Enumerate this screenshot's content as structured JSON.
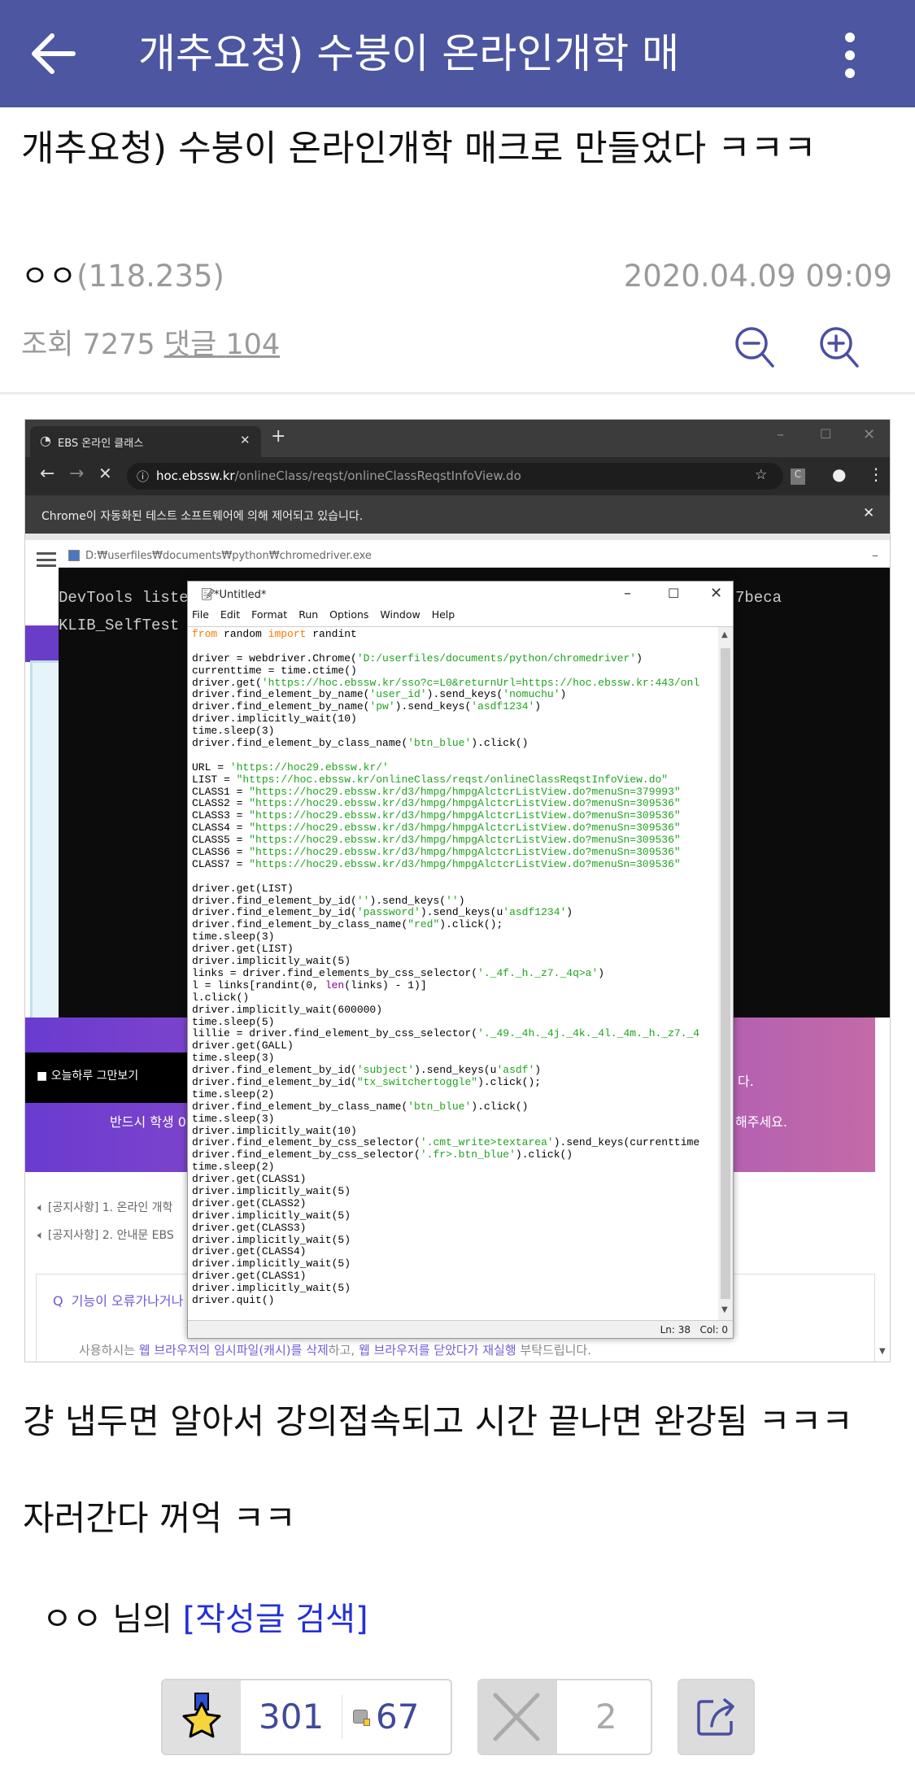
{
  "appbar": {
    "title": "개추요청) 수붕이 온라인개학 매"
  },
  "post": {
    "title": "개추요청) 수붕이 온라인개학 매크로 만들었다 ㅋㅋㅋ",
    "author": "ㅇㅇ",
    "ip": "(118.235)",
    "date": "2020.04.09 09:09",
    "views_label": "조회",
    "views": "7275",
    "comments_label": "댓글",
    "comments": "104",
    "body": [
      "걍 냅두면 알아서 강의접속되고 시간 끝나면 완강됨 ㅋㅋㅋ",
      "자러간다 꺼억 ㅋㅋ"
    ],
    "byline_author": "ㅇㅇ",
    "byline_suffix": "님의",
    "byline_link": "[작성글 검색]"
  },
  "actions": {
    "recommend": "301",
    "fixed_recommend": "67",
    "dislike": "2"
  },
  "colors": {
    "appbar": "#4d56a0",
    "accent": "#4a4fa0",
    "link": "#2430d8"
  },
  "screenshot": {
    "chrome": {
      "tab_title": "EBS 온라인 클래스",
      "url_host": "hoc.ebssw.kr",
      "url_path": "/onlineClass/reqst/onlineClassReqstInfoView.do",
      "infobar": "Chrome이 자동화된 테스트 소프트웨어에 의해 제어되고 있습니다.",
      "profile_badge": "C"
    },
    "console": {
      "title": "D:₩userfiles₩documents₩python₩chromedriver.exe",
      "line1": "DevTools listenin",
      "line2": "KLIB_SelfTest ret",
      "line1_tail": "7beca"
    },
    "page": {
      "dismiss": "오늘하루 그만보기",
      "banner_left": "반드시 학생 0",
      "banner_right1": "다.",
      "banner_right2": "해주세요.",
      "notice1": "[공지사항] 1. 온라인 개학",
      "notice2": "[공지사항] 2. 안내문 EBS",
      "faq_q": "Q",
      "faq_title": "기능이 오류가나거나",
      "faq_text_a": "사용하시는 ",
      "faq_text_b": "웹 브라우저의 임시파일(캐시)를 삭제",
      "faq_text_c": "하고, ",
      "faq_text_d": "웹 브라우저를 닫았다가 재실행",
      "faq_text_e": " 부탁드립니다."
    },
    "idle": {
      "title": "*Untitled*",
      "menu": [
        "File",
        "Edit",
        "Format",
        "Run",
        "Options",
        "Window",
        "Help"
      ],
      "status": "Ln: 38   Col: 0",
      "code": [
        [
          [
            "from",
            "k"
          ],
          [
            " random ",
            ""
          ],
          [
            "import",
            "k"
          ],
          [
            " randint",
            ""
          ]
        ],
        [],
        [
          [
            "driver = webdriver.Chrome(",
            ""
          ],
          [
            "'D:/userfiles/documents/python/chromedriver'",
            "s"
          ],
          [
            ")",
            ""
          ]
        ],
        [
          [
            "currenttime = time.ctime()",
            ""
          ]
        ],
        [
          [
            "driver.get(",
            ""
          ],
          [
            "'https://hoc.ebssw.kr/sso?c=L0&returnUrl=https://hoc.ebssw.kr:443/onl",
            "s"
          ]
        ],
        [
          [
            "driver.find_element_by_name(",
            ""
          ],
          [
            "'user_id'",
            "s"
          ],
          [
            ").send_keys(",
            ""
          ],
          [
            "'nomuchu'",
            "s"
          ],
          [
            ")",
            ""
          ]
        ],
        [
          [
            "driver.find_element_by_name(",
            ""
          ],
          [
            "'pw'",
            "s"
          ],
          [
            ").send_keys(",
            ""
          ],
          [
            "'asdf1234'",
            "s"
          ],
          [
            ")",
            ""
          ]
        ],
        [
          [
            "driver.implicitly_wait(10)",
            ""
          ]
        ],
        [
          [
            "time.sleep(3)",
            ""
          ]
        ],
        [
          [
            "driver.find_element_by_class_name(",
            ""
          ],
          [
            "'btn_blue'",
            "s"
          ],
          [
            ").click()",
            ""
          ]
        ],
        [],
        [
          [
            "URL = ",
            ""
          ],
          [
            "'https://hoc29.ebssw.kr/'",
            "s"
          ]
        ],
        [
          [
            "LIST = ",
            ""
          ],
          [
            "\"https://hoc.ebssw.kr/onlineClass/reqst/onlineClassReqstInfoView.do\"",
            "s"
          ]
        ],
        [
          [
            "CLASS1 = ",
            ""
          ],
          [
            "\"https://hoc29.ebssw.kr/d3/hmpg/hmpgAlctcrListView.do?menuSn=379993\"",
            "s"
          ]
        ],
        [
          [
            "CLASS2 = ",
            ""
          ],
          [
            "\"https://hoc29.ebssw.kr/d3/hmpg/hmpgAlctcrListView.do?menuSn=309536\"",
            "s"
          ]
        ],
        [
          [
            "CLASS3 = ",
            ""
          ],
          [
            "\"https://hoc29.ebssw.kr/d3/hmpg/hmpgAlctcrListView.do?menuSn=309536\"",
            "s"
          ]
        ],
        [
          [
            "CLASS4 = ",
            ""
          ],
          [
            "\"https://hoc29.ebssw.kr/d3/hmpg/hmpgAlctcrListView.do?menuSn=309536\"",
            "s"
          ]
        ],
        [
          [
            "CLASS5 = ",
            ""
          ],
          [
            "\"https://hoc29.ebssw.kr/d3/hmpg/hmpgAlctcrListView.do?menuSn=309536\"",
            "s"
          ]
        ],
        [
          [
            "CLASS6 = ",
            ""
          ],
          [
            "\"https://hoc29.ebssw.kr/d3/hmpg/hmpgAlctcrListView.do?menuSn=309536\"",
            "s"
          ]
        ],
        [
          [
            "CLASS7 = ",
            ""
          ],
          [
            "\"https://hoc29.ebssw.kr/d3/hmpg/hmpgAlctcrListView.do?menuSn=309536\"",
            "s"
          ]
        ],
        [],
        [
          [
            "driver.get(LIST)",
            ""
          ]
        ],
        [
          [
            "driver.find_element_by_id(",
            ""
          ],
          [
            "''",
            "s"
          ],
          [
            ").send_keys(",
            ""
          ],
          [
            "''",
            "s"
          ],
          [
            ")",
            ""
          ]
        ],
        [
          [
            "driver.find_element_by_id(",
            ""
          ],
          [
            "'password'",
            "s"
          ],
          [
            ").send_keys(u",
            ""
          ],
          [
            "'asdf1234'",
            "s"
          ],
          [
            ")",
            ""
          ]
        ],
        [
          [
            "driver.find_element_by_class_name(",
            ""
          ],
          [
            "\"red\"",
            "s"
          ],
          [
            ").click();",
            ""
          ]
        ],
        [
          [
            "time.sleep(3)",
            ""
          ]
        ],
        [
          [
            "driver.get(LIST)",
            ""
          ]
        ],
        [
          [
            "driver.implicitly_wait(5)",
            ""
          ]
        ],
        [
          [
            "links = driver.find_elements_by_css_selector(",
            ""
          ],
          [
            "'._4f._h._z7._4q>a'",
            "s"
          ],
          [
            ")",
            ""
          ]
        ],
        [
          [
            "l = links[randint(0, ",
            ""
          ],
          [
            "len",
            "b"
          ],
          [
            "(links) - 1)]",
            ""
          ]
        ],
        [
          [
            "l.click()",
            ""
          ]
        ],
        [
          [
            "driver.implicitly_wait(600000)",
            ""
          ]
        ],
        [
          [
            "time.sleep(5)",
            ""
          ]
        ],
        [
          [
            "lillie = driver.find_element_by_css_selector(",
            ""
          ],
          [
            "'._49._4h._4j._4k._4l._4m._h._z7._4",
            "s"
          ]
        ],
        [
          [
            "driver.get(GALL)",
            ""
          ]
        ],
        [
          [
            "time.sleep(3)",
            ""
          ]
        ],
        [
          [
            "driver.find_element_by_id(",
            ""
          ],
          [
            "'subject'",
            "s"
          ],
          [
            ").send_keys(u",
            ""
          ],
          [
            "'asdf'",
            "s"
          ],
          [
            ")",
            ""
          ]
        ],
        [
          [
            "driver.find_element_by_id(",
            ""
          ],
          [
            "\"tx_switchertoggle\"",
            "s"
          ],
          [
            ").click();",
            ""
          ]
        ],
        [
          [
            "time.sleep(2)",
            ""
          ]
        ],
        [
          [
            "driver.find_element_by_class_name(",
            ""
          ],
          [
            "'btn_blue'",
            "s"
          ],
          [
            ").click()",
            ""
          ]
        ],
        [
          [
            "time.sleep(3)",
            ""
          ]
        ],
        [
          [
            "driver.implicitly_wait(10)",
            ""
          ]
        ],
        [
          [
            "driver.find_element_by_css_selector(",
            ""
          ],
          [
            "'.cmt_write>textarea'",
            "s"
          ],
          [
            ").send_keys(currenttime",
            ""
          ]
        ],
        [
          [
            "driver.find_element_by_css_selector(",
            ""
          ],
          [
            "'.fr>.btn_blue'",
            "s"
          ],
          [
            ").click()",
            ""
          ]
        ],
        [
          [
            "time.sleep(2)",
            ""
          ]
        ],
        [
          [
            "driver.get(CLASS1)",
            ""
          ]
        ],
        [
          [
            "driver.implicitly_wait(5)",
            ""
          ]
        ],
        [
          [
            "driver.get(CLASS2)",
            ""
          ]
        ],
        [
          [
            "driver.implicitly_wait(5)",
            ""
          ]
        ],
        [
          [
            "driver.get(CLASS3)",
            ""
          ]
        ],
        [
          [
            "driver.implicitly_wait(5)",
            ""
          ]
        ],
        [
          [
            "driver.get(CLASS4)",
            ""
          ]
        ],
        [
          [
            "driver.implicitly_wait(5)",
            ""
          ]
        ],
        [
          [
            "driver.get(CLASS1)",
            ""
          ]
        ],
        [
          [
            "driver.implicitly_wait(5)",
            ""
          ]
        ],
        [
          [
            "driver.quit()",
            ""
          ]
        ]
      ]
    }
  }
}
